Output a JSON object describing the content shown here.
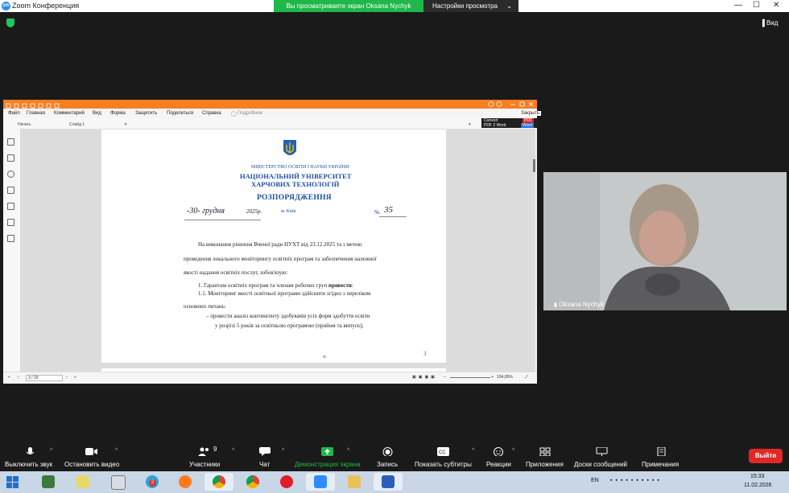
{
  "window": {
    "title": "Zoom Конференция",
    "share_banner": "Вы просматриваете экран Oksana Nychyk",
    "view_settings": "Настройки просмотра",
    "view_button": "Вид"
  },
  "pdf": {
    "menu": [
      "Файл",
      "Главная",
      "Комментарий",
      "Вид",
      "Форма",
      "Защитить",
      "Поделиться",
      "Справка",
      "Подробнее"
    ],
    "close_label": "Закрыть",
    "convert_line1": "Convert",
    "convert_line2": "PDF 2 Word",
    "convert_badge1": "PDF",
    "convert_badge2": "Word",
    "tabs": [
      "Начать",
      "Слайд 1"
    ],
    "page_indicator": "3 / 20",
    "zoom": "104,05%",
    "document": {
      "ministry": "МІНІСТЕРСТВО ОСВІТИ І НАУКИ УКРАЇНИ",
      "university_line1": "НАЦІОНАЛЬНИЙ УНІВЕРСИТЕТ",
      "university_line2": "ХАРЧОВИХ ТЕХНОЛОГІЙ",
      "doc_type": "РОЗПОРЯДЖЕННЯ",
      "date_handwritten": "-30- грудня",
      "year": "2025",
      "year_suffix": "р.",
      "city": "м. Київ",
      "number_label": "№",
      "number": "35",
      "para1_l1": "На виконання рішення Вченої ради НУХТ від 23.12.2025   та з метою",
      "para1_l2": "проведення локального моніторингу освітніх програм та забезпечення належної",
      "para1_l3": "якості надання освітніх послуг, зобов'язую:",
      "item1_prefix": "1.     Гарантам освітніх програм та членам робочих груп ",
      "item1_bold": "провести",
      "item1_suffix": ":",
      "item11_l1": "1.1.   Моніторинг якості освітньої програми здійснити згідно з переліком",
      "item11_l2": "основних питань:",
      "bullet_l1": "–   провести аналіз контингенту здобувачів усіх форм здобуття освіти",
      "bullet_l2": "у розрізі 5 років за освітньою програмою (прийом та випуск);",
      "page_number": "3"
    }
  },
  "participant": {
    "name": "Oksana Nychyk"
  },
  "toolbar": {
    "mute": "Выключить звук",
    "video": "Остановить видео",
    "participants": "Участники",
    "participants_count": "9",
    "chat": "Чат",
    "share": "Демонстрация экрана",
    "record": "Запись",
    "captions": "Показать субтитры",
    "reactions": "Реакции",
    "apps": "Приложения",
    "whiteboards": "Доски сообщений",
    "notes": "Примечания",
    "exit": "Выйти"
  },
  "taskbar": {
    "telegram_badge": "2",
    "lang": "EN",
    "time": "15:33",
    "date": "11.02.2026"
  },
  "colors": {
    "share_green": "#20b74a",
    "pdf_orange": "#f57f21",
    "exit_red": "#e02828",
    "zoom_blue": "#2d8cff"
  }
}
